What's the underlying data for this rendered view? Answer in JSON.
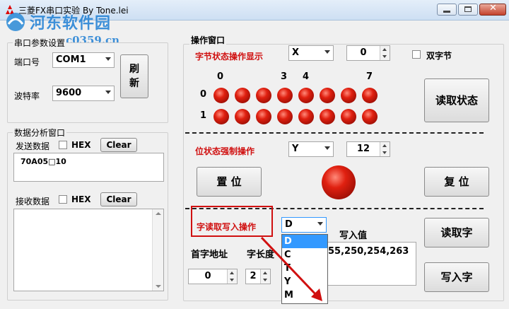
{
  "window": {
    "title": "三菱FX串口实验 By Tone.lei"
  },
  "watermark": {
    "line1": "河东软件园",
    "line2": "www.pc0359.cn"
  },
  "serial": {
    "group_label": "串口参数设置",
    "port_label": "端口号",
    "port_value": "COM1",
    "baud_label": "波特率",
    "baud_value": "9600",
    "refresh_label": "刷新"
  },
  "analysis": {
    "group_label": "数据分析窗口",
    "send_label": "发送数据",
    "hex_label": "HEX",
    "clear_label": "Clear",
    "send_text": "70A05□10",
    "recv_label": "接收数据",
    "recv_hex_label": "HEX",
    "recv_clear_label": "Clear"
  },
  "ops": {
    "group_label": "操作窗口",
    "byte_label": "字节状态操作显示",
    "byte_device": "X",
    "byte_value": "0",
    "double_byte_label": "双字节",
    "bit_headers": [
      "0",
      "",
      "",
      "3",
      "4",
      "",
      "",
      "7"
    ],
    "row_labels": [
      "0",
      "1"
    ],
    "read_status_label": "读取状态",
    "bit_label": "位状态强制操作",
    "bit_device": "Y",
    "bit_value": "12",
    "set_label": "置 位",
    "reset_label": "复 位",
    "word_label": "字读取写入操作",
    "word_device": "D",
    "device_options": [
      "D",
      "C",
      "T",
      "Y",
      "M"
    ],
    "write_value_label": "写入值",
    "write_value": "55,250,254,263",
    "start_addr_label": "首字地址",
    "start_addr_value": "0",
    "word_len_label": "字长度",
    "word_len_value": "2",
    "read_word_label": "读取字",
    "write_word_label": "写入字"
  },
  "colors": {
    "accent_red": "#d01010",
    "highlight": "#3399ff"
  }
}
